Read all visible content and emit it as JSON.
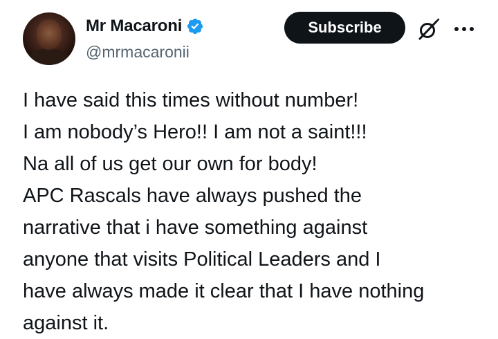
{
  "author": {
    "display_name": "Mr Macaroni",
    "handle": "@mrmacaronii",
    "verified": true,
    "avatar_icon": "profile-photo"
  },
  "actions": {
    "subscribe_label": "Subscribe",
    "grok_icon": "grok-icon",
    "more_icon": "more-icon"
  },
  "colors": {
    "verified_blue": "#1d9bf0",
    "button_bg": "#0f1419",
    "handle_gray": "#536471"
  },
  "post": {
    "lines": [
      "I have said this times without number!",
      "I am nobody’s Hero!! I am not a saint!!!",
      "Na all of us get our own for body!",
      "APC Rascals have always pushed the",
      "narrative that i have something against",
      "anyone that visits Political Leaders and I",
      "have always made it clear that I have nothing",
      "against it."
    ]
  }
}
